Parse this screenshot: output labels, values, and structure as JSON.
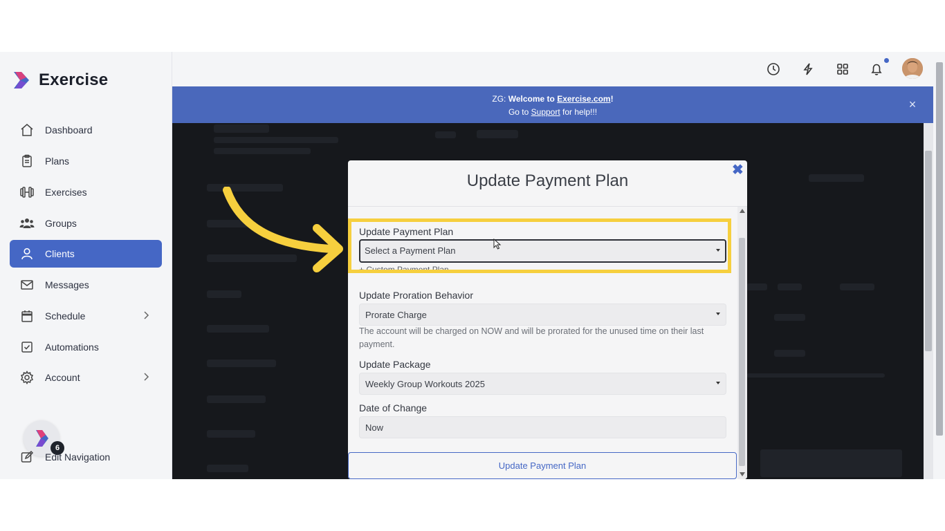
{
  "app": {
    "name": "Exercise"
  },
  "sidebar": {
    "items": [
      {
        "label": "Dashboard",
        "icon": "home-icon"
      },
      {
        "label": "Plans",
        "icon": "clipboard-icon"
      },
      {
        "label": "Exercises",
        "icon": "dumbbell-icon"
      },
      {
        "label": "Groups",
        "icon": "group-icon"
      },
      {
        "label": "Clients",
        "icon": "user-icon",
        "active": true
      },
      {
        "label": "Messages",
        "icon": "mail-icon"
      },
      {
        "label": "Schedule",
        "icon": "calendar-icon",
        "has_submenu": true
      },
      {
        "label": "Automations",
        "icon": "checkbox-icon"
      },
      {
        "label": "Account",
        "icon": "gear-icon",
        "has_submenu": true
      }
    ],
    "edit_navigation": "Edit Navigation",
    "notification_count": "6"
  },
  "topbar": {
    "icons": [
      "history-icon",
      "bolt-icon",
      "apps-grid-icon",
      "bell-icon",
      "user-avatar"
    ]
  },
  "banner": {
    "prefix": "ZG: ",
    "welcome": "Welcome to ",
    "site": "Exercise.com",
    "exclaim": "!",
    "line2_prefix": "Go to ",
    "support": "Support",
    "line2_suffix": " for help!!!",
    "close": "×"
  },
  "modal": {
    "title": "Update Payment Plan",
    "close": "✖",
    "payment_plan": {
      "label": "Update Payment Plan",
      "value": "Select a Payment Plan"
    },
    "custom_link": "+ Custom Payment Plan",
    "proration": {
      "label": "Update Proration Behavior",
      "value": "Prorate Charge",
      "help": "The account will be charged on NOW and will be prorated for the unused time on their last payment."
    },
    "package": {
      "label": "Update Package",
      "value": "Weekly Group Workouts 2025"
    },
    "date": {
      "label": "Date of Change",
      "value": "Now"
    },
    "submit": "Update Payment Plan"
  },
  "colors": {
    "accent": "#4567c5",
    "banner": "#4a68bb",
    "highlight": "#f6cf3e"
  }
}
